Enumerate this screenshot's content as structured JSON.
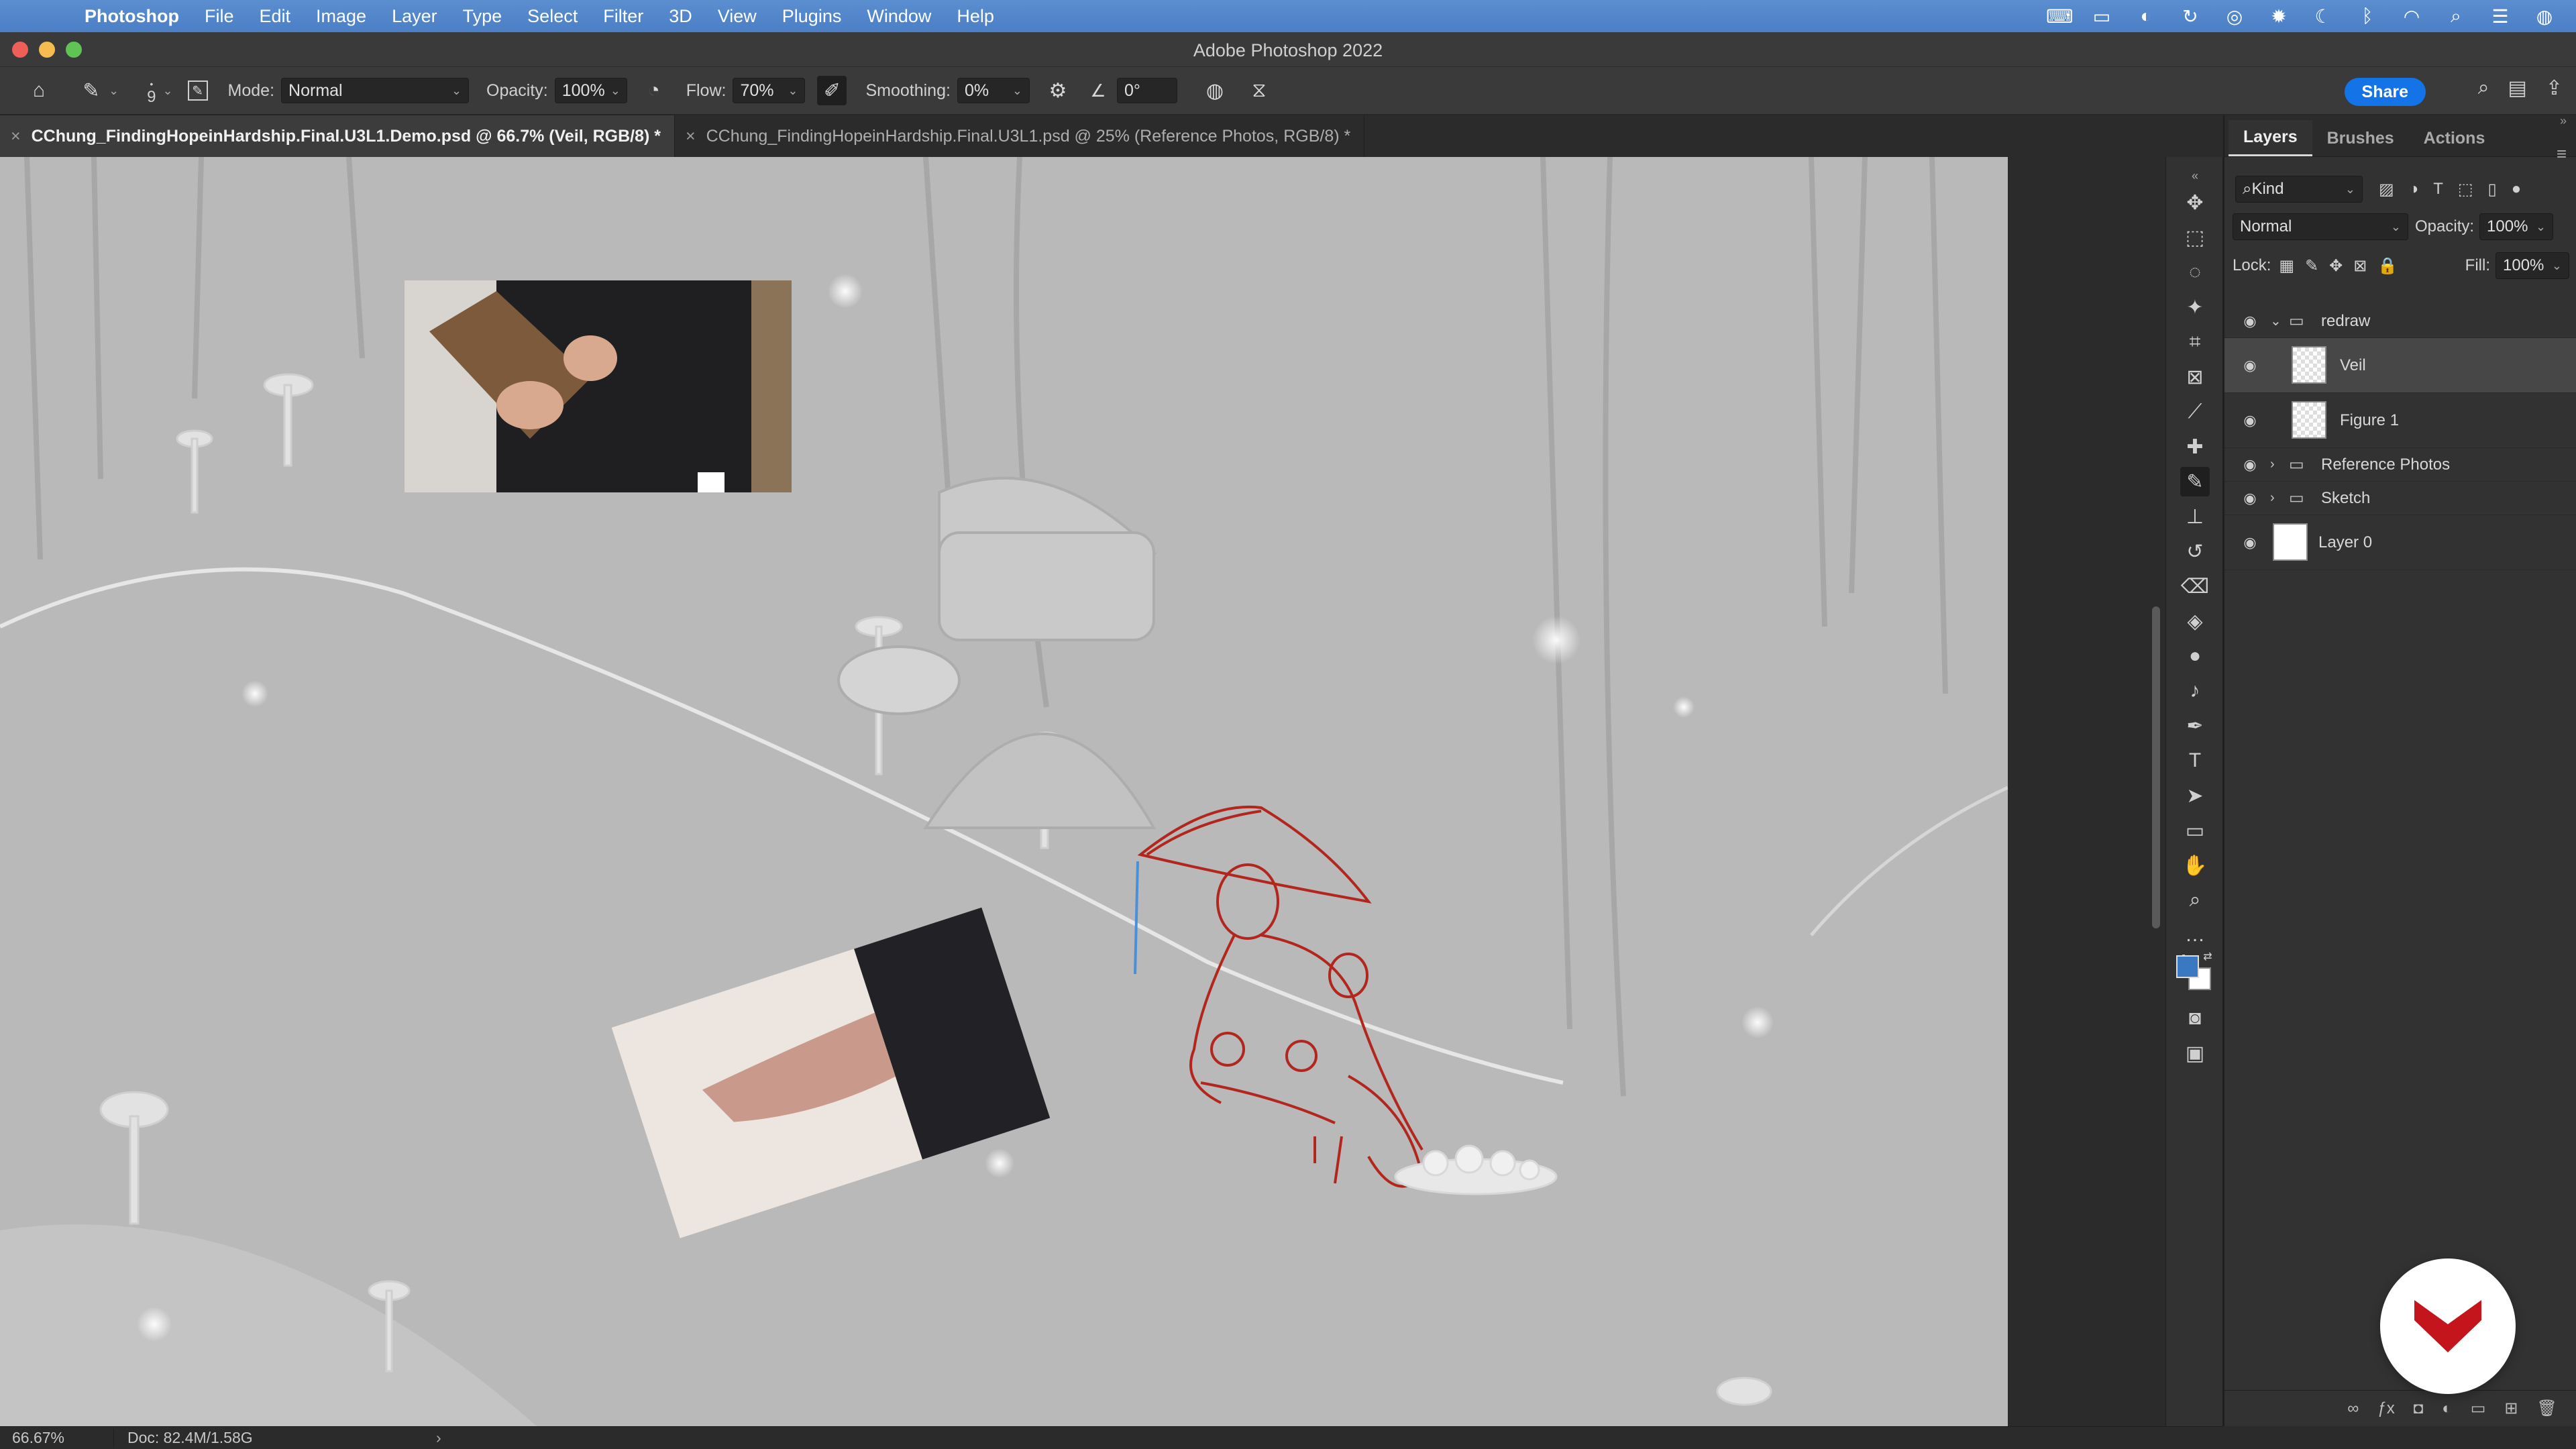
{
  "menubar": {
    "app_name": "Photoshop",
    "items": [
      "File",
      "Edit",
      "Image",
      "Layer",
      "Type",
      "Select",
      "Filter",
      "3D",
      "View",
      "Plugins",
      "Window",
      "Help"
    ],
    "status_icons": [
      "keyboard-icon",
      "display-icon",
      "sync-icon",
      "refresh-icon",
      "vpn-icon",
      "settings-icon",
      "moon-icon",
      "bluetooth-icon",
      "wifi-icon",
      "search-icon",
      "control-center-icon",
      "siri-icon"
    ]
  },
  "window": {
    "title": "Adobe Photoshop 2022"
  },
  "options_bar": {
    "brush_size": "9",
    "mode_label": "Mode:",
    "mode_value": "Normal",
    "opacity_label": "Opacity:",
    "opacity_value": "100%",
    "flow_label": "Flow:",
    "flow_value": "70%",
    "smoothing_label": "Smoothing:",
    "smoothing_value": "0%",
    "angle_value": "0°",
    "share_label": "Share"
  },
  "tabs": [
    {
      "label": "CChung_FindingHopeinHardship.Final.U3L1.Demo.psd @ 66.7% (Veil, RGB/8) *",
      "active": true
    },
    {
      "label": "CChung_FindingHopeinHardship.Final.U3L1.psd @ 25% (Reference Photos, RGB/8) *",
      "active": false
    }
  ],
  "layers_panel": {
    "tabs": [
      "Layers",
      "Brushes",
      "Actions"
    ],
    "filter_kind": "Kind",
    "blend_mode": "Normal",
    "opacity_label": "Opacity:",
    "opacity_value": "100%",
    "lock_label": "Lock:",
    "fill_label": "Fill:",
    "fill_value": "100%",
    "layers": [
      {
        "name": "redraw",
        "type": "group",
        "expanded": true
      },
      {
        "name": "Veil",
        "type": "layer",
        "selected": true
      },
      {
        "name": "Figure 1",
        "type": "layer"
      },
      {
        "name": "Reference Photos",
        "type": "group",
        "expanded": false
      },
      {
        "name": "Sketch",
        "type": "group",
        "expanded": false
      },
      {
        "name": "Layer 0",
        "type": "layer"
      }
    ]
  },
  "status_bar": {
    "zoom": "66.67%",
    "doc": "Doc: 82.4M/1.58G",
    "arrow": "›"
  },
  "colors": {
    "foreground": "#3a78c2",
    "background": "#ffffff",
    "accent": "#1473e6",
    "sketch_red": "#b3261e"
  }
}
